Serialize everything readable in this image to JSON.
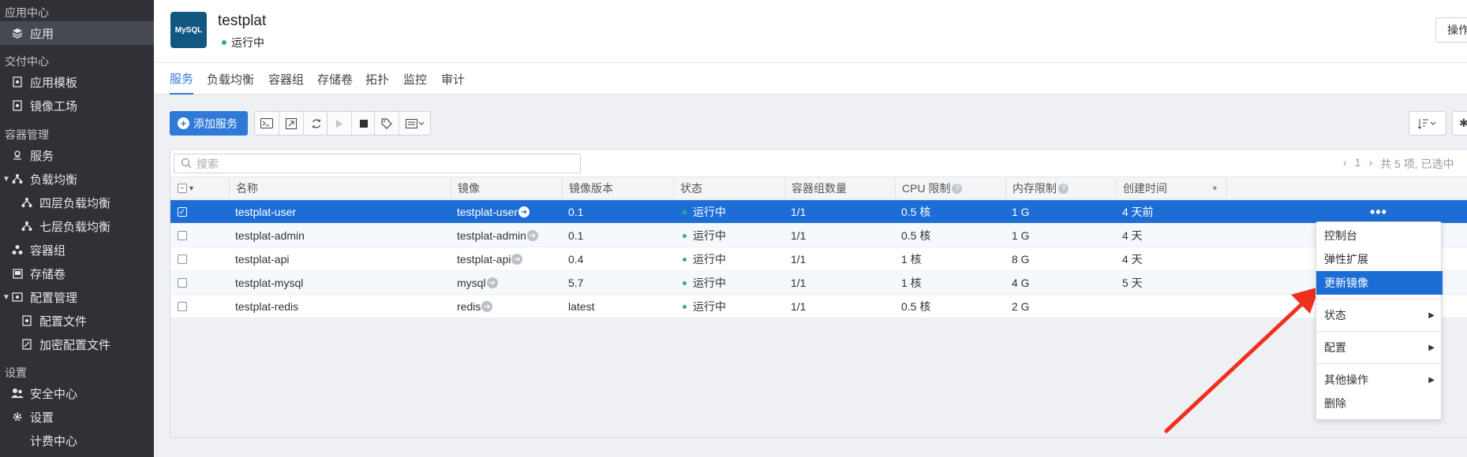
{
  "sidebar": {
    "sections": [
      {
        "label": "应用中心"
      },
      {
        "label": "交付中心"
      },
      {
        "label": "容器管理"
      },
      {
        "label": "设置"
      }
    ],
    "items": [
      {
        "label": "应用",
        "icon": "layers-icon"
      },
      {
        "label": "应用模板",
        "icon": "template-icon"
      },
      {
        "label": "镜像工场",
        "icon": "image-factory-icon"
      },
      {
        "label": "服务",
        "icon": "service-icon"
      },
      {
        "label": "负载均衡",
        "icon": "load-balance-icon"
      },
      {
        "label": "四层负载均衡",
        "icon": "load-balance-icon"
      },
      {
        "label": "七层负载均衡",
        "icon": "load-balance-icon"
      },
      {
        "label": "容器组",
        "icon": "pods-icon"
      },
      {
        "label": "存储卷",
        "icon": "storage-icon"
      },
      {
        "label": "配置管理",
        "icon": "config-icon"
      },
      {
        "label": "配置文件",
        "icon": "config-file-icon"
      },
      {
        "label": "加密配置文件",
        "icon": "secret-file-icon"
      },
      {
        "label": "安全中心",
        "icon": "users-icon"
      },
      {
        "label": "设置",
        "icon": "gear-icon"
      },
      {
        "label": "计费中心",
        "icon": ""
      }
    ]
  },
  "app": {
    "logo_text": "MySQL",
    "title": "testplat",
    "status": "运行中",
    "operate_label": "操作"
  },
  "tabs": [
    "服务",
    "负载均衡",
    "容器组",
    "存储卷",
    "拓扑",
    "监控",
    "审计"
  ],
  "toolbar": {
    "add_label": "添加服务"
  },
  "search": {
    "placeholder": "搜索"
  },
  "pager": {
    "page": "1",
    "summary": "共 5 项, 已选中"
  },
  "table": {
    "columns": [
      "名称",
      "镜像",
      "镜像版本",
      "状态",
      "容器组数量",
      "CPU 限制",
      "内存限制",
      "创建时间"
    ],
    "rows": [
      {
        "name": "testplat-user",
        "image": "testplat-user",
        "version": "0.1",
        "status": "运行中",
        "pods": "1/1",
        "cpu": "0.5 核",
        "mem": "1 G",
        "created": "4 天前"
      },
      {
        "name": "testplat-admin",
        "image": "testplat-admin",
        "version": "0.1",
        "status": "运行中",
        "pods": "1/1",
        "cpu": "0.5 核",
        "mem": "1 G",
        "created": "4 天"
      },
      {
        "name": "testplat-api",
        "image": "testplat-api",
        "version": "0.4",
        "status": "运行中",
        "pods": "1/1",
        "cpu": "1 核",
        "mem": "8 G",
        "created": "4 天"
      },
      {
        "name": "testplat-mysql",
        "image": "mysql",
        "version": "5.7",
        "status": "运行中",
        "pods": "1/1",
        "cpu": "1 核",
        "mem": "4 G",
        "created": "5 天"
      },
      {
        "name": "testplat-redis",
        "image": "redis",
        "version": "latest",
        "status": "运行中",
        "pods": "1/1",
        "cpu": "0.5 核",
        "mem": "2 G",
        "created": ""
      }
    ]
  },
  "context_menu": {
    "console": "控制台",
    "scale": "弹性扩展",
    "update_image": "更新镜像",
    "status": "状态",
    "config": "配置",
    "other": "其他操作",
    "delete": "删除"
  },
  "colors": {
    "accent": "#2f7ad9",
    "selected_row": "#1c6ed6",
    "running": "#2bb673",
    "sidebar_bg": "#2f3136",
    "annotation_arrow": "#f0301f"
  }
}
